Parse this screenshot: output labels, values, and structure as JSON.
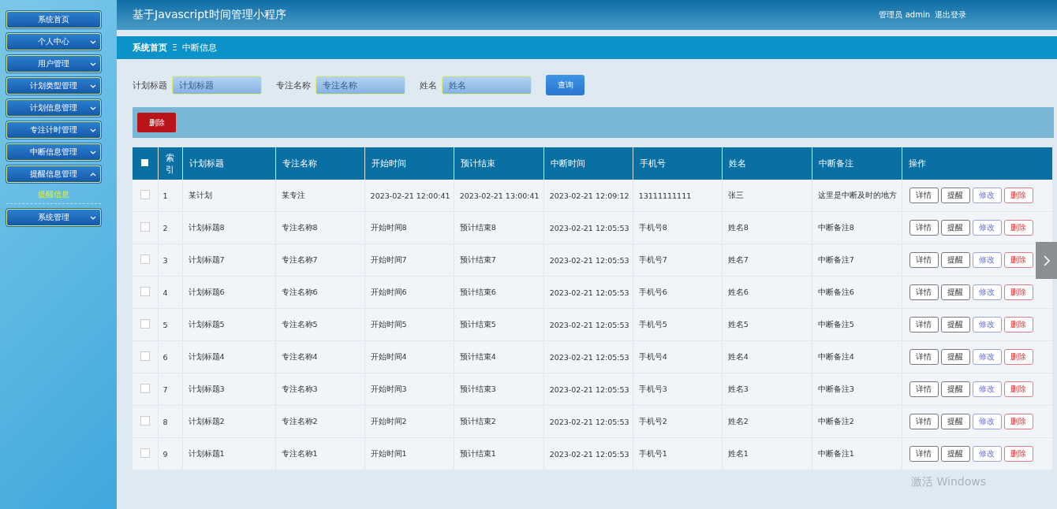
{
  "header": {
    "title": "基于Javascript时间管理小程序",
    "user": "管理员 admin",
    "logout": "退出登录"
  },
  "sidebar": {
    "items": [
      {
        "label": "系统首页",
        "has_caret": false
      },
      {
        "label": "个人中心",
        "has_caret": true,
        "expanded": false
      },
      {
        "label": "用户管理",
        "has_caret": true,
        "expanded": false
      },
      {
        "label": "计划类型管理",
        "has_caret": true,
        "expanded": false
      },
      {
        "label": "计划信息管理",
        "has_caret": true,
        "expanded": false
      },
      {
        "label": "专注计时管理",
        "has_caret": true,
        "expanded": false
      },
      {
        "label": "中断信息管理",
        "has_caret": true,
        "expanded": false
      },
      {
        "label": "提醒信息管理",
        "has_caret": true,
        "expanded": true,
        "children": [
          {
            "label": "提醒信息"
          }
        ]
      },
      {
        "label": "系统管理",
        "has_caret": true,
        "expanded": false
      }
    ]
  },
  "breadcrumb": {
    "home": "系统首页",
    "separator": "Ξ",
    "current": "中断信息"
  },
  "search": {
    "fields": [
      {
        "label": "计划标题",
        "placeholder": "计划标题"
      },
      {
        "label": "专注名称",
        "placeholder": "专注名称"
      },
      {
        "label": "姓名",
        "placeholder": "姓名"
      }
    ],
    "button": "查询"
  },
  "toolbar": {
    "delete": "删除"
  },
  "table": {
    "columns": [
      "索引",
      "计划标题",
      "专注名称",
      "开始时间",
      "预计结束",
      "中断时间",
      "手机号",
      "姓名",
      "中断备注",
      "操作"
    ],
    "all_checked": false,
    "rows": [
      {
        "checked": false,
        "cells": [
          "1",
          "某计划",
          "某专注",
          "2023-02-21 12:00:41",
          "2023-02-21 13:00:41",
          "2023-02-21 12:09:12",
          "13111111111",
          "张三",
          "这里是中断及时的地方"
        ],
        "actions": [
          "详情",
          "提醒",
          "修改",
          "删除"
        ]
      },
      {
        "checked": false,
        "cells": [
          "2",
          "计划标题8",
          "专注名称8",
          "开始时间8",
          "预计结束8",
          "2023-02-21 12:05:53",
          "手机号8",
          "姓名8",
          "中断备注8"
        ],
        "actions": [
          "详情",
          "提醒",
          "修改",
          "删除"
        ]
      },
      {
        "checked": false,
        "cells": [
          "3",
          "计划标题7",
          "专注名称7",
          "开始时间7",
          "预计结束7",
          "2023-02-21 12:05:53",
          "手机号7",
          "姓名7",
          "中断备注7"
        ],
        "actions": [
          "详情",
          "提醒",
          "修改",
          "删除"
        ]
      },
      {
        "checked": false,
        "cells": [
          "4",
          "计划标题6",
          "专注名称6",
          "开始时间6",
          "预计结束6",
          "2023-02-21 12:05:53",
          "手机号6",
          "姓名6",
          "中断备注6"
        ],
        "actions": [
          "详情",
          "提醒",
          "修改",
          "删除"
        ]
      },
      {
        "checked": false,
        "cells": [
          "5",
          "计划标题5",
          "专注名称5",
          "开始时间5",
          "预计结束5",
          "2023-02-21 12:05:53",
          "手机号5",
          "姓名5",
          "中断备注5"
        ],
        "actions": [
          "详情",
          "提醒",
          "修改",
          "删除"
        ]
      },
      {
        "checked": false,
        "cells": [
          "6",
          "计划标题4",
          "专注名称4",
          "开始时间4",
          "预计结束4",
          "2023-02-21 12:05:53",
          "手机号4",
          "姓名4",
          "中断备注4"
        ],
        "actions": [
          "详情",
          "提醒",
          "修改",
          "删除"
        ]
      },
      {
        "checked": false,
        "cells": [
          "7",
          "计划标题3",
          "专注名称3",
          "开始时间3",
          "预计结束3",
          "2023-02-21 12:05:53",
          "手机号3",
          "姓名3",
          "中断备注3"
        ],
        "actions": [
          "详情",
          "提醒",
          "修改",
          "删除"
        ]
      },
      {
        "checked": false,
        "cells": [
          "8",
          "计划标题2",
          "专注名称2",
          "开始时间2",
          "预计结束2",
          "2023-02-21 12:05:53",
          "手机号2",
          "姓名2",
          "中断备注2"
        ],
        "actions": [
          "详情",
          "提醒",
          "修改",
          "删除"
        ]
      },
      {
        "checked": false,
        "cells": [
          "9",
          "计划标题1",
          "专注名称1",
          "开始时间1",
          "预计结束1",
          "2023-02-21 12:05:53",
          "手机号1",
          "姓名1",
          "中断备注1"
        ],
        "actions": [
          "详情",
          "提醒",
          "修改",
          "删除"
        ]
      }
    ]
  },
  "os_notice": "激活 Windows"
}
